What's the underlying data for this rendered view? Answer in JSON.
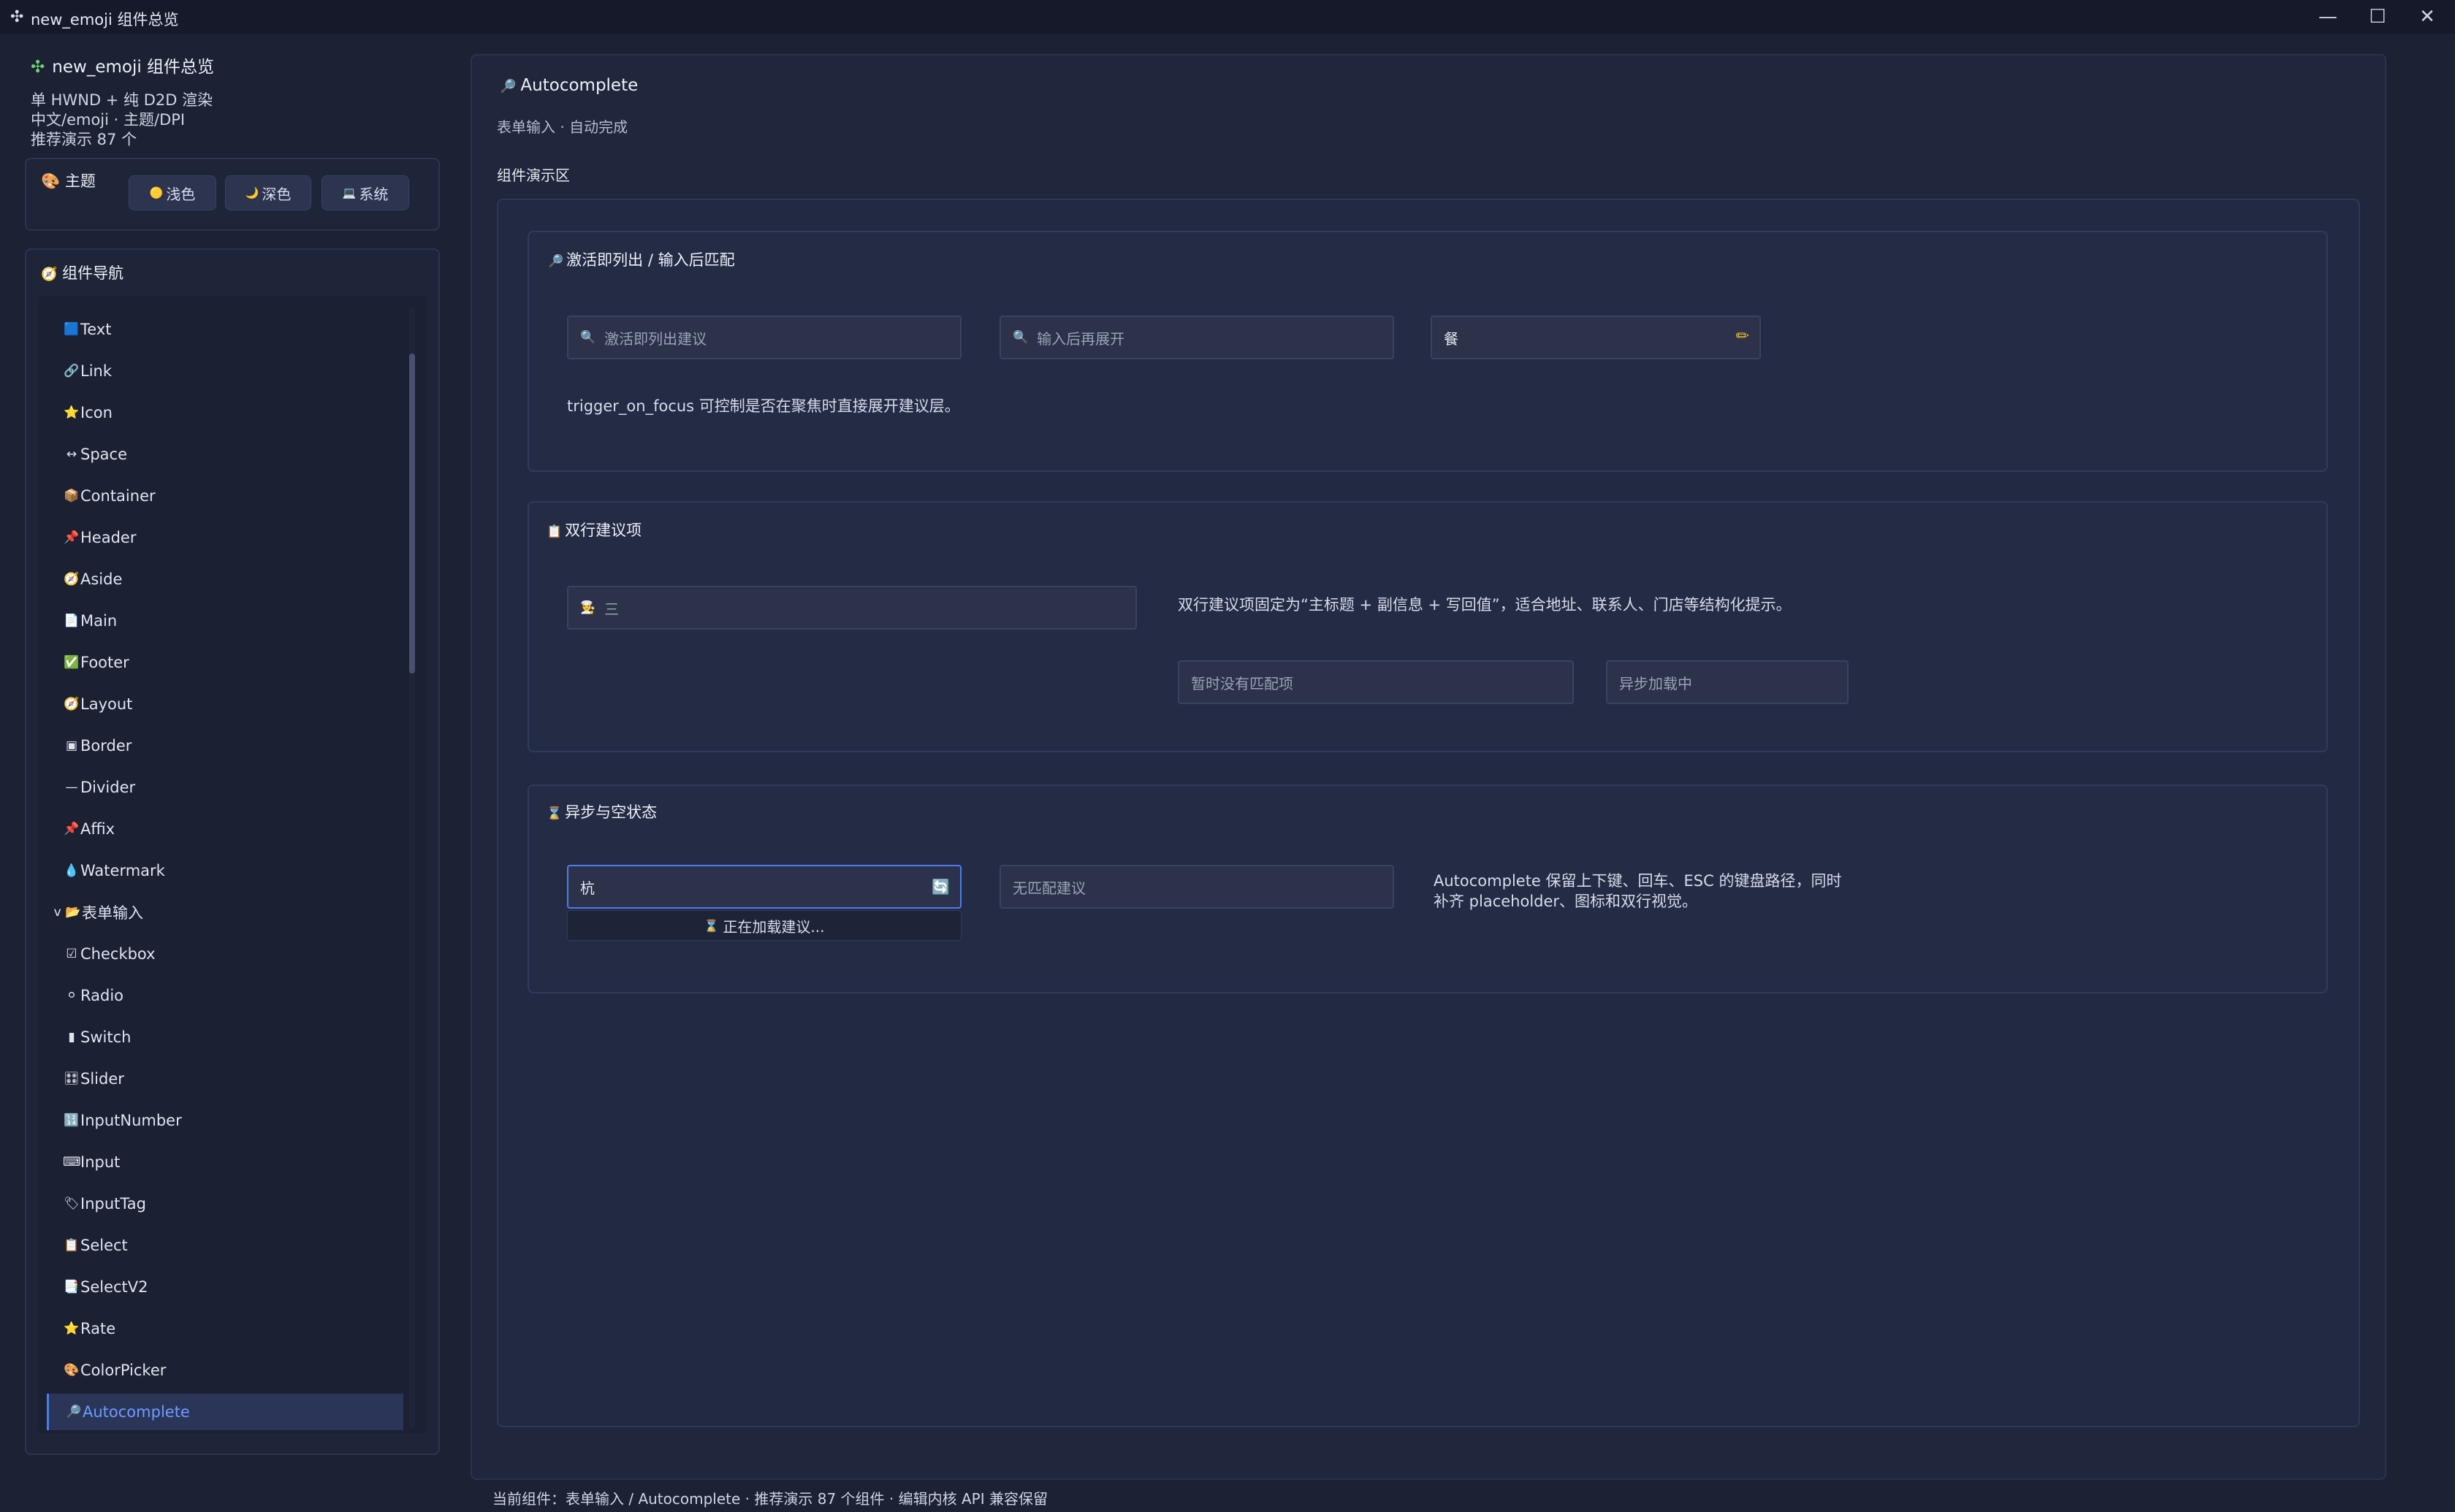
{
  "window": {
    "title": "new_emoji 组件总览",
    "app_icon": "✣",
    "minimize": "—",
    "maximize": "☐",
    "close": "✕"
  },
  "sidebar": {
    "app_title": "new_emoji 组件总览",
    "info_lines": [
      "单 HWND + 纯 D2D 渲染",
      "中文/emoji · 主题/DPI",
      "推荐演示 87 个"
    ],
    "theme": {
      "title": "主题",
      "icon": "🎨",
      "buttons": [
        {
          "icon": "🟡",
          "label": "浅色"
        },
        {
          "icon": "🌙",
          "label": "深色"
        },
        {
          "icon": "💻",
          "label": "系统"
        }
      ]
    },
    "nav": {
      "title": "组件导航",
      "icon": "🧭",
      "items": [
        {
          "icon": "🟦",
          "label": "Text"
        },
        {
          "icon": "🔗",
          "label": "Link"
        },
        {
          "icon": "⭐",
          "label": "Icon"
        },
        {
          "icon": "↔",
          "label": "Space"
        },
        {
          "icon": "📦",
          "label": "Container"
        },
        {
          "icon": "📌",
          "label": "Header"
        },
        {
          "icon": "🧭",
          "label": "Aside"
        },
        {
          "icon": "📄",
          "label": "Main"
        },
        {
          "icon": "✅",
          "label": "Footer"
        },
        {
          "icon": "🧭",
          "label": "Layout"
        },
        {
          "icon": "▣",
          "label": "Border"
        },
        {
          "icon": "—",
          "label": "Divider"
        },
        {
          "icon": "📌",
          "label": "Affix"
        },
        {
          "icon": "💧",
          "label": "Watermark"
        },
        {
          "icon": "v 📂",
          "label": "表单输入"
        },
        {
          "icon": "☑",
          "label": "Checkbox"
        },
        {
          "icon": "⚪",
          "label": "Radio"
        },
        {
          "icon": "▮",
          "label": "Switch"
        },
        {
          "icon": "🎛",
          "label": "Slider"
        },
        {
          "icon": "🔢",
          "label": "InputNumber"
        },
        {
          "icon": "⌨",
          "label": "Input"
        },
        {
          "icon": "🏷",
          "label": "InputTag"
        },
        {
          "icon": "📋",
          "label": "Select"
        },
        {
          "icon": "📑",
          "label": "SelectV2"
        },
        {
          "icon": "⭐",
          "label": "Rate"
        },
        {
          "icon": "🎨",
          "label": "ColorPicker"
        },
        {
          "icon": "🔎",
          "label": "Autocomplete"
        }
      ]
    }
  },
  "main": {
    "title": "Autocomplete",
    "title_icon": "🔎",
    "subtitle": "表单输入 · 自动完成",
    "demo_label": "组件演示区",
    "card1": {
      "title": "激活即列出 / 输入后匹配",
      "icon": "🔎",
      "field1": {
        "icon": "🔍",
        "placeholder": "激活即列出建议"
      },
      "field2": {
        "icon": "🔍",
        "placeholder": "输入后再展开"
      },
      "field3": {
        "value": "餐",
        "trail_icon": "✏"
      },
      "desc": "trigger_on_focus 可控制是否在聚焦时直接展开建议层。"
    },
    "card2": {
      "title": "双行建议项",
      "icon": "📋",
      "field1": {
        "icon": "🧑‍🍳",
        "value": "三"
      },
      "desc": "双行建议项固定为“主标题 + 副信息 + 写回值”，适合地址、联系人、门店等结构化提示。",
      "field2": {
        "placeholder": "暂时没有匹配项"
      },
      "field3": {
        "placeholder": "异步加载中"
      }
    },
    "card3": {
      "title": "异步与空状态",
      "icon": "⌛",
      "field1": {
        "value": "杭",
        "trail_icon": "🔄"
      },
      "loading": {
        "icon": "⌛",
        "text": "正在加载建议..."
      },
      "field2": {
        "placeholder": "无匹配建议"
      },
      "desc": "Autocomplete 保留上下键、回车、ESC 的键盘路径，同时补齐 placeholder、图标和双行视觉。"
    }
  },
  "status_bar": "当前组件：表单输入 / Autocomplete · 推荐演示 87 个组件 · 编辑内核 API 兼容保留"
}
